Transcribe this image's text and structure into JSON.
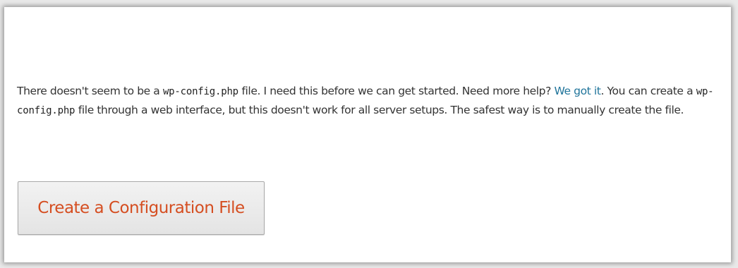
{
  "message": {
    "part1": "There doesn't seem to be a ",
    "code1": "wp-config.php",
    "part2": " file. I need this before we can get started. Need more help? ",
    "link_text": "We got it",
    "part3": ". You can create a ",
    "code2": "wp-config.php",
    "part4": " file through a web interface, but this doesn't work for all server setups. The safest way is to manually create the file."
  },
  "button": {
    "label": "Create a Configuration File"
  },
  "colors": {
    "link": "#21759b",
    "button_text": "#d54e21",
    "body_text": "#333333"
  }
}
